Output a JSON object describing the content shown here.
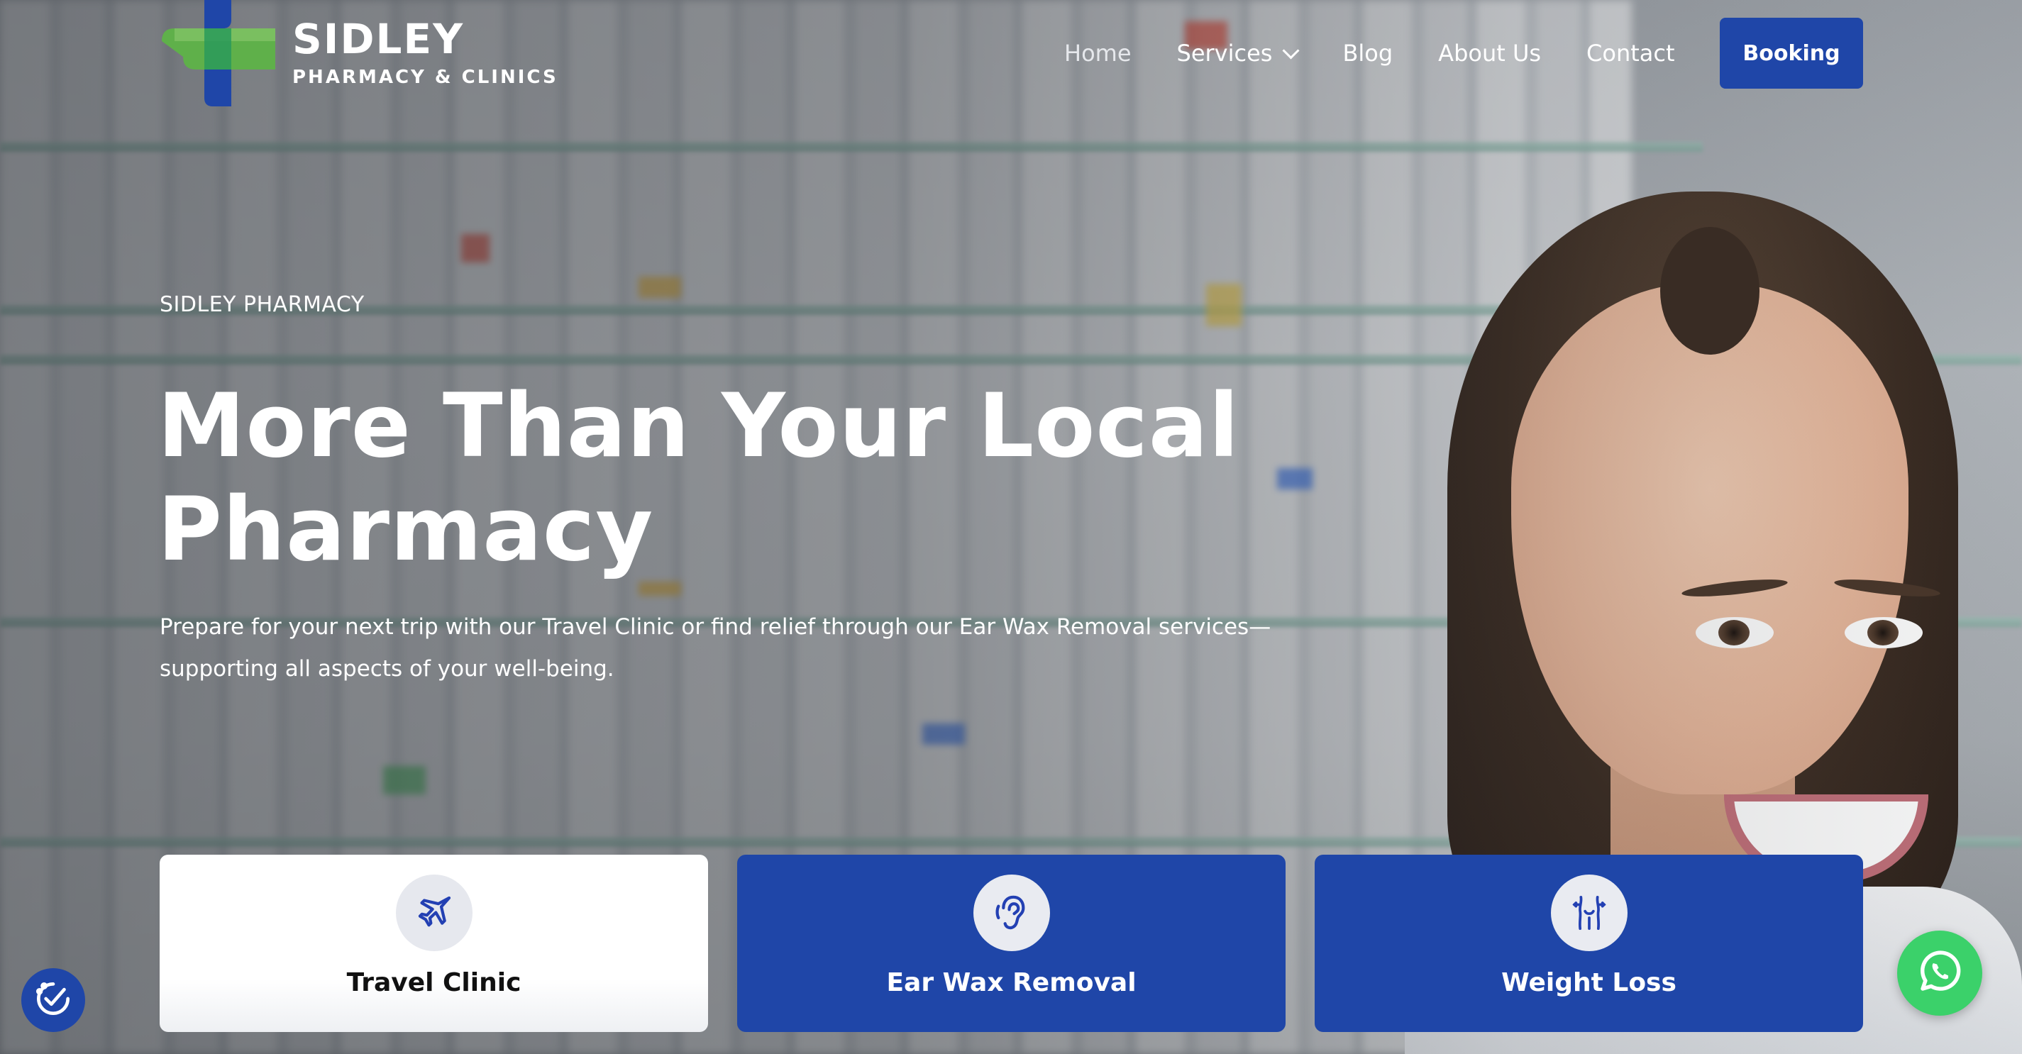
{
  "brand": {
    "name": "SIDLEY",
    "subtitle": "PHARMACY & CLINICS",
    "colors": {
      "green": "#5fb04a",
      "blue": "#1f46a8"
    },
    "logo_icon": "cross-logo-icon"
  },
  "nav": {
    "items": [
      {
        "label": "Home"
      },
      {
        "label": "Services",
        "icon": "chevron-down-icon"
      },
      {
        "label": "Blog"
      },
      {
        "label": "About Us"
      },
      {
        "label": "Contact"
      }
    ],
    "booking_label": "Booking"
  },
  "hero": {
    "eyebrow": "SIDLEY PHARMACY",
    "title_line1": "More Than Your Local",
    "title_line2": "Pharmacy",
    "description": "Prepare for your next trip with our Travel Clinic or find relief through our Ear Wax Removal services—supporting all aspects of your well-being."
  },
  "services": [
    {
      "label": "Travel Clinic",
      "icon": "airplane-icon",
      "style": "light"
    },
    {
      "label": "Ear Wax Removal",
      "icon": "ear-icon",
      "style": "blue"
    },
    {
      "label": "Weight Loss",
      "icon": "body-waist-icon",
      "style": "blue"
    }
  ],
  "floating": {
    "accessibility_icon": "accessibility-icon",
    "whatsapp_icon": "whatsapp-icon"
  },
  "colors": {
    "primary": "#1f46a8",
    "whatsapp": "#3bd16a",
    "text_on_dark": "#ffffff"
  }
}
